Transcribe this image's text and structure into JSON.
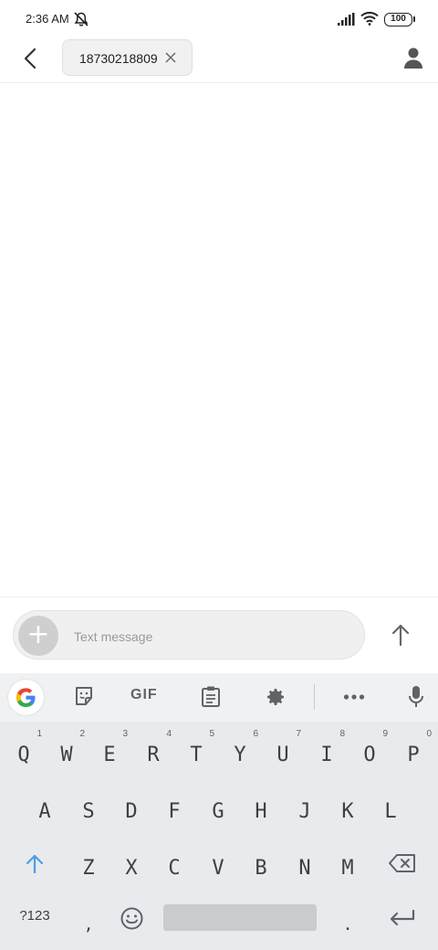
{
  "status": {
    "time": "2:36 AM",
    "battery": "100",
    "icons": [
      "bell-off-icon",
      "signal-icon",
      "wifi-icon",
      "battery-icon"
    ]
  },
  "header": {
    "back_icon": "back-arrow-icon",
    "recipient": "18730218809",
    "chip_close_icon": "close-icon",
    "contact_icon": "person-icon"
  },
  "compose": {
    "attach_icon": "plus-icon",
    "placeholder": "Text message",
    "value": "",
    "send_icon": "send-arrow-icon"
  },
  "keyboard": {
    "toolbar": {
      "google": "google-icon",
      "sticker": "sticker-icon",
      "gif": "GIF",
      "clipboard": "clipboard-icon",
      "settings": "gear-icon",
      "more": "more-icon",
      "mic": "mic-icon"
    },
    "row1": [
      {
        "key": "Q",
        "hint": "1"
      },
      {
        "key": "W",
        "hint": "2"
      },
      {
        "key": "E",
        "hint": "3"
      },
      {
        "key": "R",
        "hint": "4"
      },
      {
        "key": "T",
        "hint": "5"
      },
      {
        "key": "Y",
        "hint": "6"
      },
      {
        "key": "U",
        "hint": "7"
      },
      {
        "key": "I",
        "hint": "8"
      },
      {
        "key": "O",
        "hint": "9"
      },
      {
        "key": "P",
        "hint": "0"
      }
    ],
    "row2": [
      "A",
      "S",
      "D",
      "F",
      "G",
      "H",
      "J",
      "K",
      "L"
    ],
    "row3": [
      "Z",
      "X",
      "C",
      "V",
      "B",
      "N",
      "M"
    ],
    "shift_icon": "shift-icon",
    "backspace_icon": "backspace-icon",
    "symbols": "?123",
    "comma": ",",
    "emoji_icon": "emoji-icon",
    "period": ".",
    "enter_icon": "enter-icon",
    "accent_color": "#4a9ee8"
  }
}
